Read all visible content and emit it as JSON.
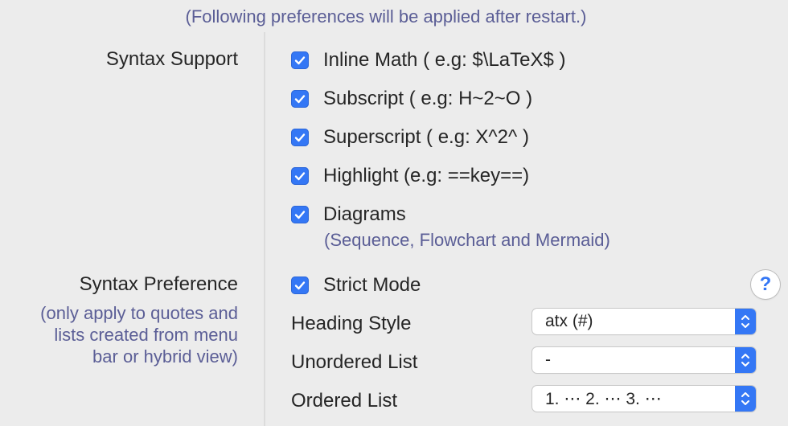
{
  "notice": "(Following preferences will be applied after restart.)",
  "syntax_support": {
    "label": "Syntax Support",
    "items": [
      {
        "label": "Inline Math ( e.g: $\\LaTeX$ )",
        "checked": true
      },
      {
        "label": "Subscript ( e.g: H~2~O )",
        "checked": true
      },
      {
        "label": "Superscript ( e.g: X^2^ )",
        "checked": true
      },
      {
        "label": "Highlight (e.g: ==key==)",
        "checked": true
      },
      {
        "label": "Diagrams",
        "checked": true,
        "sublabel": "(Sequence, Flowchart and Mermaid)"
      }
    ]
  },
  "syntax_preference": {
    "label": "Syntax Preference",
    "note_lines": [
      "(only apply to quotes and",
      "lists created from menu",
      "bar or hybrid view)"
    ],
    "strict_mode": {
      "label": "Strict Mode",
      "checked": true
    },
    "help_label": "?",
    "heading_style": {
      "label": "Heading Style",
      "value": "atx (#)"
    },
    "unordered_list": {
      "label": "Unordered List",
      "value": "-"
    },
    "ordered_list": {
      "label": "Ordered List",
      "value": "1. ⋯ 2. ⋯ 3. ⋯"
    }
  },
  "colors": {
    "accent": "#3477f5",
    "note": "#5b5e96",
    "background": "#ececec"
  }
}
